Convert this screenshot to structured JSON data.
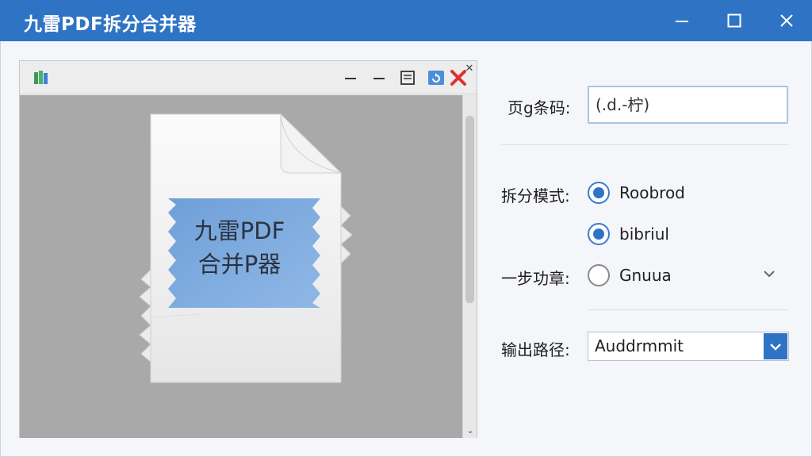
{
  "window": {
    "title": "九雷PDF拆分合并器"
  },
  "preview": {
    "doc_label_line1": "九雷PDF",
    "doc_label_line2": "合并P器"
  },
  "form": {
    "page_range_label": "页g条码:",
    "page_range_value": "(.d.-柠)",
    "split_mode_label": "拆分模式:",
    "split_options": [
      {
        "label": "Roobrod",
        "selected": true
      },
      {
        "label": "bibriul",
        "selected": true
      }
    ],
    "step_label": "一步功章:",
    "step_option": {
      "label": "Gnuua",
      "selected": false
    },
    "output_label": "输出路径:",
    "output_value": "Auddrmmit"
  },
  "colors": {
    "accent": "#2f74c4",
    "titlebar": "#2f74c4",
    "close_red": "#e03030"
  }
}
